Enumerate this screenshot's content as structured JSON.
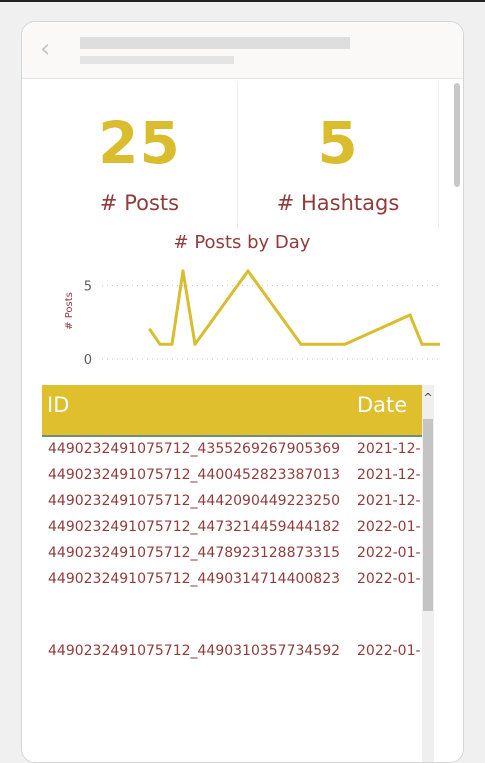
{
  "kpis": [
    {
      "value": "25",
      "label": "# Posts"
    },
    {
      "value": "5",
      "label": "# Hashtags"
    }
  ],
  "chart_data": {
    "type": "line",
    "title": "# Posts by Day",
    "xlabel": "",
    "ylabel": "# Posts",
    "yticks": [
      "5",
      "0"
    ],
    "ylim": [
      0,
      6
    ],
    "grid": true,
    "color": "#d9bd2e",
    "series": [
      {
        "values": [
          2,
          1,
          1,
          6,
          1,
          6,
          1,
          1,
          3,
          1,
          1
        ]
      }
    ]
  },
  "table": {
    "columns": [
      "ID",
      "Date"
    ],
    "rows": [
      {
        "id": "4490232491075712_4355269267905369",
        "date": "2021-12-"
      },
      {
        "id": "4490232491075712_4400452823387013",
        "date": "2021-12-"
      },
      {
        "id": "4490232491075712_4442090449223250",
        "date": "2021-12-"
      },
      {
        "id": "4490232491075712_4473214459444182",
        "date": "2022-01-"
      },
      {
        "id": "4490232491075712_4478923128873315",
        "date": "2022-01-"
      },
      {
        "id": "4490232491075712_4490314714400823",
        "date": "2022-01-"
      },
      {
        "id": "",
        "date": ""
      },
      {
        "id": "4490232491075712_4490310357734592",
        "date": "2022-01-"
      }
    ]
  },
  "icons": {
    "back": "chevron-left-icon",
    "scroll_up": "chevron-up-icon"
  },
  "colors": {
    "accent": "#d9bd2e",
    "text": "#913b3b",
    "header_bg": "#dfbf2d"
  }
}
